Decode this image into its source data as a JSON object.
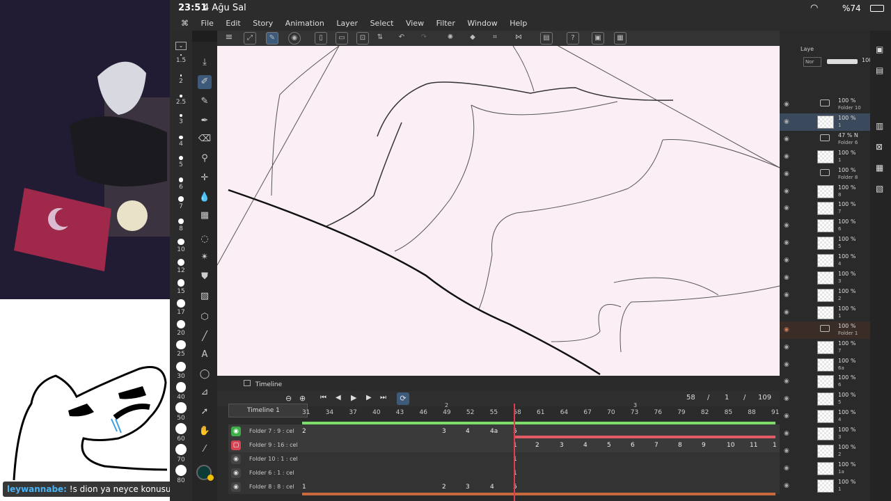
{
  "status": {
    "time": "23:51",
    "date": "4 Ağu Sal",
    "battery": "%74"
  },
  "menu": [
    "File",
    "Edit",
    "Story",
    "Animation",
    "Layer",
    "Select",
    "View",
    "Filter",
    "Window",
    "Help"
  ],
  "brush_sizes": [
    "1.5",
    "2",
    "2.5",
    "3",
    "4",
    "5",
    "6",
    "7",
    "8",
    "10",
    "12",
    "15",
    "17",
    "20",
    "25",
    "30",
    "40",
    "50",
    "60",
    "70",
    "80"
  ],
  "timeline": {
    "panel_title": "Timeline",
    "name": "Timeline 1",
    "current_frame": "58",
    "slash1": "/",
    "page": "1",
    "slash2": "/",
    "total": "109",
    "ruler": [
      "31",
      "34",
      "37",
      "40",
      "43",
      "46",
      "49",
      "52",
      "55",
      "58",
      "61",
      "64",
      "67",
      "70",
      "73",
      "76",
      "79",
      "82",
      "85",
      "88",
      "91"
    ],
    "ruler_top": [
      "2",
      "3"
    ],
    "tracks": [
      {
        "name": "Folder 7 : 9 : cel",
        "cells": [
          "2",
          "3",
          "4",
          "4a",
          "5"
        ]
      },
      {
        "name": "Folder 9 : 16 : cel",
        "cells": [
          "1",
          "2",
          "3",
          "4",
          "5",
          "6",
          "7",
          "8",
          "9",
          "10",
          "11",
          "1"
        ]
      },
      {
        "name": "Folder 10 : 1 : cel",
        "cells": [
          "1"
        ]
      },
      {
        "name": "Folder 6 : 1 : cel",
        "cells": [
          "1"
        ]
      },
      {
        "name": "Folder 8 : 8 : cel",
        "cells": [
          "1",
          "2",
          "3",
          "4",
          "5"
        ]
      }
    ]
  },
  "layers": {
    "tab_label": "Laye",
    "blend": "Nor",
    "opacity": "100",
    "rows": [
      {
        "pct": "100 %",
        "name": "Folder 10",
        "type": "folder"
      },
      {
        "pct": "100 %",
        "name": "1",
        "type": "layer"
      },
      {
        "pct": "47 % N",
        "name": "Folder 6",
        "type": "folder"
      },
      {
        "pct": "100 %",
        "name": "1",
        "type": "layer"
      },
      {
        "pct": "100 %",
        "name": "Folder 8",
        "type": "folder"
      },
      {
        "pct": "100 %",
        "name": "8",
        "type": "layer"
      },
      {
        "pct": "100 %",
        "name": "7",
        "type": "layer"
      },
      {
        "pct": "100 %",
        "name": "6",
        "type": "layer"
      },
      {
        "pct": "100 %",
        "name": "5",
        "type": "layer"
      },
      {
        "pct": "100 %",
        "name": "4",
        "type": "layer"
      },
      {
        "pct": "100 %",
        "name": "3",
        "type": "layer"
      },
      {
        "pct": "100 %",
        "name": "2",
        "type": "layer"
      },
      {
        "pct": "100 %",
        "name": "1",
        "type": "layer"
      },
      {
        "pct": "100 %",
        "name": "Folder 1",
        "type": "folder"
      },
      {
        "pct": "100 %",
        "name": "7",
        "type": "layer"
      },
      {
        "pct": "100 %",
        "name": "6a",
        "type": "layer"
      },
      {
        "pct": "100 %",
        "name": "6",
        "type": "layer"
      },
      {
        "pct": "100 %",
        "name": "5",
        "type": "layer"
      },
      {
        "pct": "100 %",
        "name": "4",
        "type": "layer"
      },
      {
        "pct": "100 %",
        "name": "3",
        "type": "layer"
      },
      {
        "pct": "100 %",
        "name": "2",
        "type": "layer"
      },
      {
        "pct": "100 %",
        "name": "1a",
        "type": "layer"
      },
      {
        "pct": "100 %",
        "name": "1",
        "type": "layer"
      }
    ]
  },
  "chat": {
    "user": "leywannabe:",
    "message": "!s dion ya neyce konusuonuz die"
  },
  "colors": {
    "canvas": "#fbeef4",
    "playhead": "#e23b4a",
    "track_green": "#7ddc6a",
    "track_red": "#e25a66"
  }
}
